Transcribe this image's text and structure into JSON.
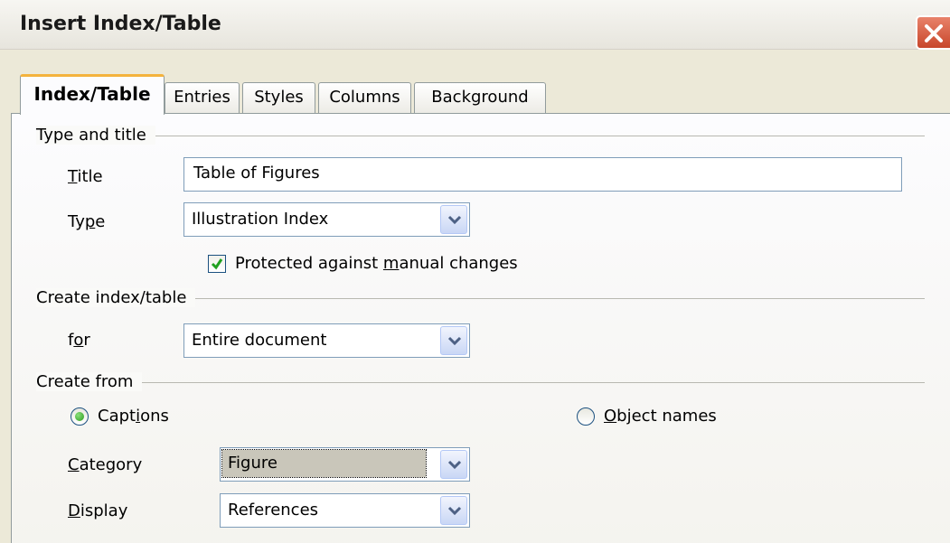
{
  "window": {
    "title": "Insert Index/Table"
  },
  "tabs": [
    {
      "label": "Index/Table",
      "active": true
    },
    {
      "label": "Entries"
    },
    {
      "label": "Styles"
    },
    {
      "label": "Columns"
    },
    {
      "label": "Background"
    }
  ],
  "type_and_title": {
    "heading": "Type and title",
    "title_label": {
      "mnemonic": "T",
      "rest": "itle"
    },
    "title_value": "Table of Figures",
    "type_label": {
      "pre": "Ty",
      "mnemonic": "p",
      "post": "e"
    },
    "type_value": "Illustration Index",
    "protected": {
      "pre": "Protected against ",
      "mnemonic": "m",
      "post": "anual changes",
      "checked": true
    }
  },
  "create_index": {
    "heading": "Create index/table",
    "for_label": {
      "pre": "f",
      "mnemonic": "o",
      "post": "r"
    },
    "for_value": "Entire document"
  },
  "create_from": {
    "heading": "Create from",
    "captions": {
      "pre": "Capt",
      "mnemonic": "i",
      "post": "ons",
      "selected": true
    },
    "object_names": {
      "mnemonic": "O",
      "rest": "bject names",
      "selected": false
    },
    "category_label": {
      "mnemonic": "C",
      "rest": "ategory"
    },
    "category_value": "Figure",
    "display_label": {
      "mnemonic": "D",
      "rest": "isplay"
    },
    "display_value": "References"
  },
  "icons": {
    "close": "close-icon",
    "dropdown": "chevron-down-icon",
    "check": "checkmark-icon",
    "radio": "radio-dot-icon"
  },
  "colors": {
    "tab_highlight": "#f4b33d",
    "close_button": "#c8472b",
    "check_green": "#21a121"
  }
}
